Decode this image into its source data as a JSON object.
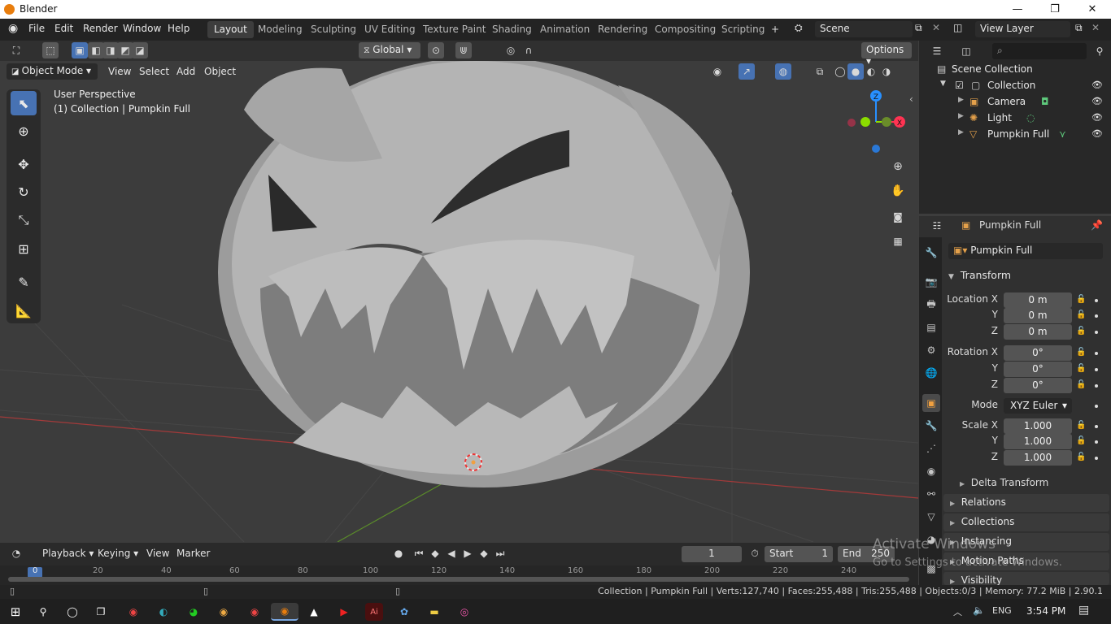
{
  "window": {
    "title": "Blender",
    "minimize": "—",
    "maximize": "❐",
    "close": "✕"
  },
  "menus": [
    "File",
    "Edit",
    "Render",
    "Window",
    "Help"
  ],
  "workspaces": [
    "Layout",
    "Modeling",
    "Sculpting",
    "UV Editing",
    "Texture Paint",
    "Shading",
    "Animation",
    "Rendering",
    "Compositing",
    "Scripting"
  ],
  "workspace_add": "+",
  "scene": {
    "name": "Scene",
    "view_layer": "View Layer"
  },
  "header": {
    "orientation": "Global",
    "options": "Options",
    "mode": "Object Mode",
    "view": "View",
    "select": "Select",
    "add": "Add",
    "object": "Object"
  },
  "viewport": {
    "perspective": "User Perspective",
    "collection_info": "(1) Collection | Pumpkin Full",
    "gizmo": {
      "z": "Z",
      "x": "X",
      "y": "Y"
    }
  },
  "outliner": {
    "search_placeholder": "",
    "root": "Scene Collection",
    "collection": "Collection",
    "items": [
      "Camera",
      "Light",
      "Pumpkin Full"
    ]
  },
  "properties": {
    "object_name": "Pumpkin Full",
    "data_name": "Pumpkin Full",
    "transform_label": "Transform",
    "location": {
      "label": "Location X",
      "x": "0 m",
      "y": "0 m",
      "z": "0 m"
    },
    "rotation": {
      "label": "Rotation X",
      "x": "0°",
      "y": "0°",
      "z": "0°"
    },
    "mode_label": "Mode",
    "mode_value": "XYZ Euler",
    "scale": {
      "label": "Scale X",
      "x": "1.000",
      "y": "1.000",
      "z": "1.000"
    },
    "axis_y": "Y",
    "axis_z": "Z",
    "panels": [
      "Delta Transform",
      "Relations",
      "Collections",
      "Instancing",
      "Motion Paths",
      "Visibility"
    ]
  },
  "timeline": {
    "playback": "Playback",
    "keying": "Keying",
    "view": "View",
    "marker": "Marker",
    "current_frame": "1",
    "start_label": "Start",
    "start": "1",
    "end_label": "End",
    "end": "250",
    "ruler": [
      "0",
      "20",
      "40",
      "60",
      "80",
      "100",
      "120",
      "140",
      "160",
      "180",
      "200",
      "220",
      "240"
    ]
  },
  "status": "Collection | Pumpkin Full | Verts:127,740 | Faces:255,488 | Tris:255,488 | Objects:0/3 | Memory: 77.2 MiB | 2.90.1",
  "watermark": {
    "line1": "Activate Windows",
    "line2": "Go to Settings to activate Windows."
  },
  "taskbar": {
    "lang": "ENG",
    "time": "3:54 PM"
  },
  "colors": {
    "accent": "#4772b3",
    "x_axis": "#ff3352",
    "y_axis": "#8bdc00",
    "z_axis": "#2890ff"
  }
}
